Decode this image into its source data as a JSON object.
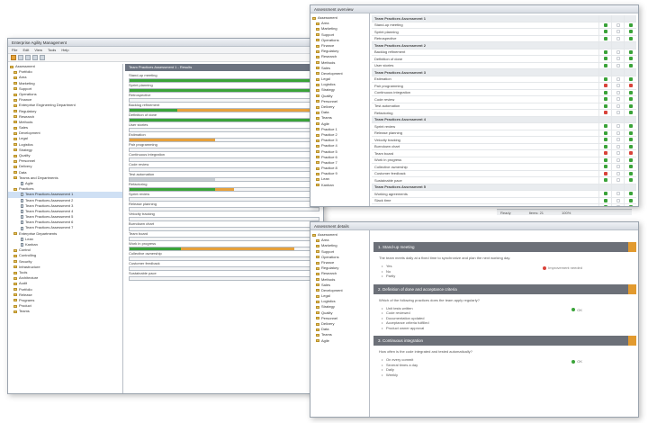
{
  "main": {
    "title": "Enterprise Agility Management",
    "menu": [
      "File",
      "Edit",
      "View",
      "Tools",
      "Help"
    ],
    "tree": [
      {
        "label": "Assessment",
        "icon": "folder"
      },
      {
        "label": "Portfolio",
        "icon": "folder"
      },
      {
        "label": "Area",
        "icon": "folder"
      },
      {
        "label": "Marketing",
        "icon": "folder"
      },
      {
        "label": "Support",
        "icon": "folder"
      },
      {
        "label": "Operations",
        "icon": "folder"
      },
      {
        "label": "Finance",
        "icon": "folder"
      },
      {
        "label": "Enterprise Engineering Department",
        "icon": "folder"
      },
      {
        "label": "Regulatory",
        "icon": "folder"
      },
      {
        "label": "Research",
        "icon": "folder"
      },
      {
        "label": "Methods",
        "icon": "folder"
      },
      {
        "label": "Sales",
        "icon": "folder"
      },
      {
        "label": "Development",
        "icon": "folder"
      },
      {
        "label": "Legal",
        "icon": "folder"
      },
      {
        "label": "Logistics",
        "icon": "folder"
      },
      {
        "label": "Strategy",
        "icon": "folder"
      },
      {
        "label": "Quality",
        "icon": "folder"
      },
      {
        "label": "Personnel",
        "icon": "folder"
      },
      {
        "label": "Delivery",
        "icon": "folder"
      },
      {
        "label": "Data",
        "icon": "folder"
      },
      {
        "label": "Teams and Departments",
        "icon": "folder"
      },
      {
        "label": "Agile",
        "icon": "doc"
      },
      {
        "label": "Practices",
        "icon": "folder"
      },
      {
        "label": "Team Practices Assessment 1",
        "icon": "doc",
        "selected": true
      },
      {
        "label": "Team Practices Assessment 2",
        "icon": "doc"
      },
      {
        "label": "Team Practices Assessment 3",
        "icon": "doc"
      },
      {
        "label": "Team Practices Assessment 4",
        "icon": "doc"
      },
      {
        "label": "Team Practices Assessment 5",
        "icon": "doc"
      },
      {
        "label": "Team Practices Assessment 6",
        "icon": "doc"
      },
      {
        "label": "Team Practices Assessment 7",
        "icon": "doc"
      },
      {
        "label": "Enterprise Departments",
        "icon": "folder"
      },
      {
        "label": "Lean",
        "icon": "doc"
      },
      {
        "label": "Kanban",
        "icon": "doc"
      },
      {
        "label": "Control",
        "icon": "folder"
      },
      {
        "label": "Controlling",
        "icon": "folder"
      },
      {
        "label": "Security",
        "icon": "folder"
      },
      {
        "label": "Infrastructure",
        "icon": "folder"
      },
      {
        "label": "Tools",
        "icon": "folder"
      },
      {
        "label": "Architecture",
        "icon": "folder"
      },
      {
        "label": "Audit",
        "icon": "folder"
      },
      {
        "label": "Portfolio",
        "icon": "folder"
      },
      {
        "label": "Release",
        "icon": "folder"
      },
      {
        "label": "Programs",
        "icon": "folder"
      },
      {
        "label": "Product",
        "icon": "folder"
      },
      {
        "label": "Teams",
        "icon": "folder"
      }
    ],
    "panel_title": "Team Practices Assessment 1 - Results",
    "bars": [
      {
        "label": "Stand-up meeting",
        "green": 100,
        "orange": 0
      },
      {
        "label": "Sprint planning",
        "green": 100,
        "orange": 0
      },
      {
        "label": "Retrospective",
        "green": 0,
        "orange": 0
      },
      {
        "label": "Backlog refinement",
        "green": 25,
        "orange": 75
      },
      {
        "label": "Definition of done",
        "green": 100,
        "orange": 0
      },
      {
        "label": "User stories",
        "green": 0,
        "orange": 0
      },
      {
        "label": "Estimation",
        "green": 0,
        "orange": 45
      },
      {
        "label": "Pair programming",
        "green": 0,
        "orange": 0
      },
      {
        "label": "Continuous integration",
        "green": 0,
        "orange": 0
      },
      {
        "label": "Code review",
        "green": 0,
        "orange": 0
      },
      {
        "label": "Test automation",
        "green": 0,
        "orange": 0,
        "gray": 45
      },
      {
        "label": "Refactoring",
        "green": 45,
        "orange": 10
      },
      {
        "label": "Sprint review",
        "green": 0,
        "orange": 0
      },
      {
        "label": "Release planning",
        "green": 0,
        "orange": 0
      },
      {
        "label": "Velocity tracking",
        "green": 0,
        "orange": 0
      },
      {
        "label": "Burndown chart",
        "green": 0,
        "orange": 0
      },
      {
        "label": "Team board",
        "green": 0,
        "orange": 0
      },
      {
        "label": "Work in progress",
        "green": 27,
        "orange": 60
      },
      {
        "label": "Collective ownership",
        "green": 0,
        "orange": 0
      },
      {
        "label": "Customer feedback",
        "green": 0,
        "orange": 0
      },
      {
        "label": "Sustainable pace",
        "green": 0,
        "orange": 0
      }
    ]
  },
  "grid": {
    "title": "Assessment overview",
    "tree": [
      "Assessment",
      "Area",
      "Marketing",
      "Support",
      "Operations",
      "Finance",
      "Regulatory",
      "Research",
      "Methods",
      "Sales",
      "Development",
      "Legal",
      "Logistics",
      "Strategy",
      "Quality",
      "Personnel",
      "Delivery",
      "Data",
      "Teams",
      "Agile",
      "Practice 1",
      "Practice 2",
      "Practice 3",
      "Practice 4",
      "Practice 5",
      "Practice 6",
      "Practice 7",
      "Practice 8",
      "Practice 9",
      "Lean",
      "Kanban"
    ],
    "rows": [
      {
        "name": "Team Practices Assessment 1",
        "head": true,
        "c": [
          "",
          "",
          ""
        ]
      },
      {
        "name": "Stand-up meeting",
        "c": [
          "ok",
          "none",
          "ok"
        ]
      },
      {
        "name": "Sprint planning",
        "c": [
          "ok",
          "none",
          "ok"
        ]
      },
      {
        "name": "Retrospective",
        "c": [
          "ok",
          "none",
          "ok"
        ]
      },
      {
        "name": "Team Practices Assessment 2",
        "head": true,
        "c": [
          "",
          "",
          ""
        ]
      },
      {
        "name": "Backlog refinement",
        "c": [
          "ok",
          "none",
          "ok"
        ]
      },
      {
        "name": "Definition of done",
        "c": [
          "ok",
          "none",
          "ok"
        ]
      },
      {
        "name": "User stories",
        "c": [
          "ok",
          "none",
          "ok"
        ]
      },
      {
        "name": "Team Practices Assessment 3",
        "head": true,
        "c": [
          "",
          "",
          ""
        ]
      },
      {
        "name": "Estimation",
        "c": [
          "ok",
          "none",
          "ok"
        ]
      },
      {
        "name": "Pair programming",
        "c": [
          "bad",
          "none",
          "bad"
        ]
      },
      {
        "name": "Continuous integration",
        "c": [
          "ok",
          "none",
          "ok"
        ]
      },
      {
        "name": "Code review",
        "c": [
          "ok",
          "none",
          "ok"
        ]
      },
      {
        "name": "Test automation",
        "c": [
          "ok",
          "none",
          "ok"
        ]
      },
      {
        "name": "Refactoring",
        "c": [
          "bad",
          "none",
          "ok"
        ]
      },
      {
        "name": "Team Practices Assessment 4",
        "head": true,
        "c": [
          "",
          "",
          ""
        ]
      },
      {
        "name": "Sprint review",
        "c": [
          "ok",
          "none",
          "ok"
        ]
      },
      {
        "name": "Release planning",
        "c": [
          "ok",
          "none",
          "ok"
        ]
      },
      {
        "name": "Velocity tracking",
        "c": [
          "ok",
          "none",
          "ok"
        ]
      },
      {
        "name": "Burndown chart",
        "c": [
          "ok",
          "none",
          "ok"
        ]
      },
      {
        "name": "Team board",
        "c": [
          "bad",
          "none",
          "bad"
        ]
      },
      {
        "name": "Work in progress",
        "c": [
          "ok",
          "none",
          "ok"
        ]
      },
      {
        "name": "Collective ownership",
        "c": [
          "ok",
          "none",
          "ok"
        ]
      },
      {
        "name": "Customer feedback",
        "c": [
          "bad",
          "none",
          "ok"
        ]
      },
      {
        "name": "Sustainable pace",
        "c": [
          "ok",
          "none",
          "ok"
        ]
      },
      {
        "name": "Team Practices Assessment 5",
        "head": true,
        "c": [
          "",
          "",
          ""
        ]
      },
      {
        "name": "Working agreements",
        "c": [
          "ok",
          "none",
          "ok"
        ]
      },
      {
        "name": "Slack time",
        "c": [
          "ok",
          "none",
          "ok"
        ]
      },
      {
        "name": "Innovation",
        "c": [
          "ok",
          "none",
          "ok"
        ]
      }
    ]
  },
  "statusbar": {
    "items": [
      "Ready",
      "Items: 21",
      "100%"
    ]
  },
  "detail": {
    "title": "Assessment details",
    "tree": [
      "Assessment",
      "Area",
      "Marketing",
      "Support",
      "Operations",
      "Finance",
      "Regulatory",
      "Research",
      "Methods",
      "Sales",
      "Development",
      "Legal",
      "Logistics",
      "Strategy",
      "Quality",
      "Personnel",
      "Delivery",
      "Data",
      "Teams",
      "Agile"
    ],
    "sections": [
      {
        "title": "1. Stand-up meeting",
        "text": "The team meets daily at a fixed time to synchronize and plan the next working day.",
        "bullets": [
          "Yes",
          "No",
          "Partly"
        ],
        "note": "Improvement needed",
        "note_color": "#d9433a"
      },
      {
        "title": "2. Definition of done and acceptance criteria",
        "text": "Which of the following practices does the team apply regularly?",
        "bullets": [
          "Unit tests written",
          "Code reviewed",
          "Documentation updated",
          "Acceptance criteria fulfilled",
          "Product owner approval"
        ],
        "note": "OK",
        "note_color": "#3aa339"
      },
      {
        "title": "3. Continuous integration",
        "text": "How often is the code integrated and tested automatically?",
        "bullets": [
          "On every commit",
          "Several times a day",
          "Daily",
          "Weekly"
        ],
        "note": "OK",
        "note_color": "#3aa339"
      }
    ]
  }
}
